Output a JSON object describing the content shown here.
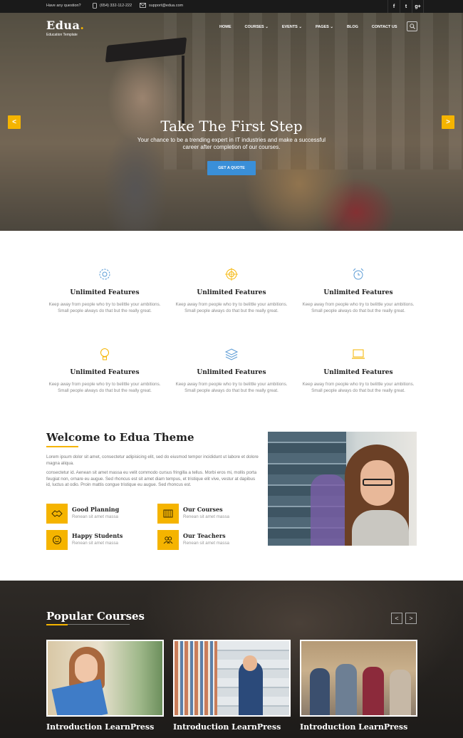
{
  "topbar": {
    "question": "Have any question?",
    "phone": "(654) 332-112-222",
    "email": "support@edua.com",
    "social": [
      "f",
      "t",
      "g+"
    ]
  },
  "header": {
    "logo_name": "Edua",
    "logo_dot": ".",
    "logo_tagline": "Education Template",
    "nav": [
      "HOME",
      "COURSES",
      "EVENTS",
      "PAGES",
      "BLOG",
      "CONTACT US"
    ]
  },
  "hero": {
    "title": "Take The First Step",
    "subtitle": "Your chance to be a trending expert in IT industries and make a successful career after completion of our courses.",
    "button": "GET A QUOTE",
    "prev": "<",
    "next": ">"
  },
  "features": [
    {
      "icon": "gear-icon",
      "title": "Unlimited Features",
      "text": "Keep away from people who try to belittle your ambitions. Small people always do that but the really great."
    },
    {
      "icon": "target-icon",
      "title": "Unlimited Features",
      "text": "Keep away from people who try to belittle your ambitions. Small people always do that but the really great."
    },
    {
      "icon": "alarm-clock-icon",
      "title": "Unlimited Features",
      "text": "Keep away from people who try to belittle your ambitions. Small people always do that but the really great."
    },
    {
      "icon": "lightbulb-icon",
      "title": "Unlimited Features",
      "text": "Keep away from people who try to belittle your ambitions. Small people always do that but the really great."
    },
    {
      "icon": "layers-icon",
      "title": "Unlimited Features",
      "text": "Keep away from people who try to belittle your ambitions. Small people always do that but the really great."
    },
    {
      "icon": "laptop-icon",
      "title": "Unlimited Features",
      "text": "Keep away from people who try to belittle your ambitions. Small people always do that but the really great."
    }
  ],
  "welcome": {
    "title": "Welcome to Edua Theme",
    "p1": "Lorem ipsum dolor sit amet, consectetur adipisicing elit, sed do eiusmod tempor incididunt ut labore et dolore magna aliqua.",
    "p2": "consectetur id. Aenean sit amet massa eu velit commodo cursus fringilla a tellus. Morbi eros mi, mollis porta feugiat non, ornare eu augue. Sed rhoncus est sit amet diam tempus, et tristique elit vive, vestur at dapibus id, luctus at odio. Proin mattis congue tristique eu augue. Sed rhoncus est.",
    "items": [
      {
        "icon": "handshake-icon",
        "title": "Good Planning",
        "sub": "Renean sit amet massa"
      },
      {
        "icon": "book-icon",
        "title": "Our Courses",
        "sub": "Renean sit amet massa"
      },
      {
        "icon": "smiley-icon",
        "title": "Happy Students",
        "sub": "Renean sit amet massa"
      },
      {
        "icon": "teacher-icon",
        "title": "Our Teachers",
        "sub": "Renean sit amet massa"
      }
    ]
  },
  "courses": {
    "title": "Popular Courses",
    "prev": "<",
    "next": ">",
    "cards": [
      {
        "title": "Introduction LearnPress"
      },
      {
        "title": "Introduction LearnPress"
      },
      {
        "title": "Introduction LearnPress"
      }
    ]
  },
  "colors": {
    "accent": "#f5b400",
    "button": "#3a8fd8",
    "dark": "#1a1a1a"
  }
}
